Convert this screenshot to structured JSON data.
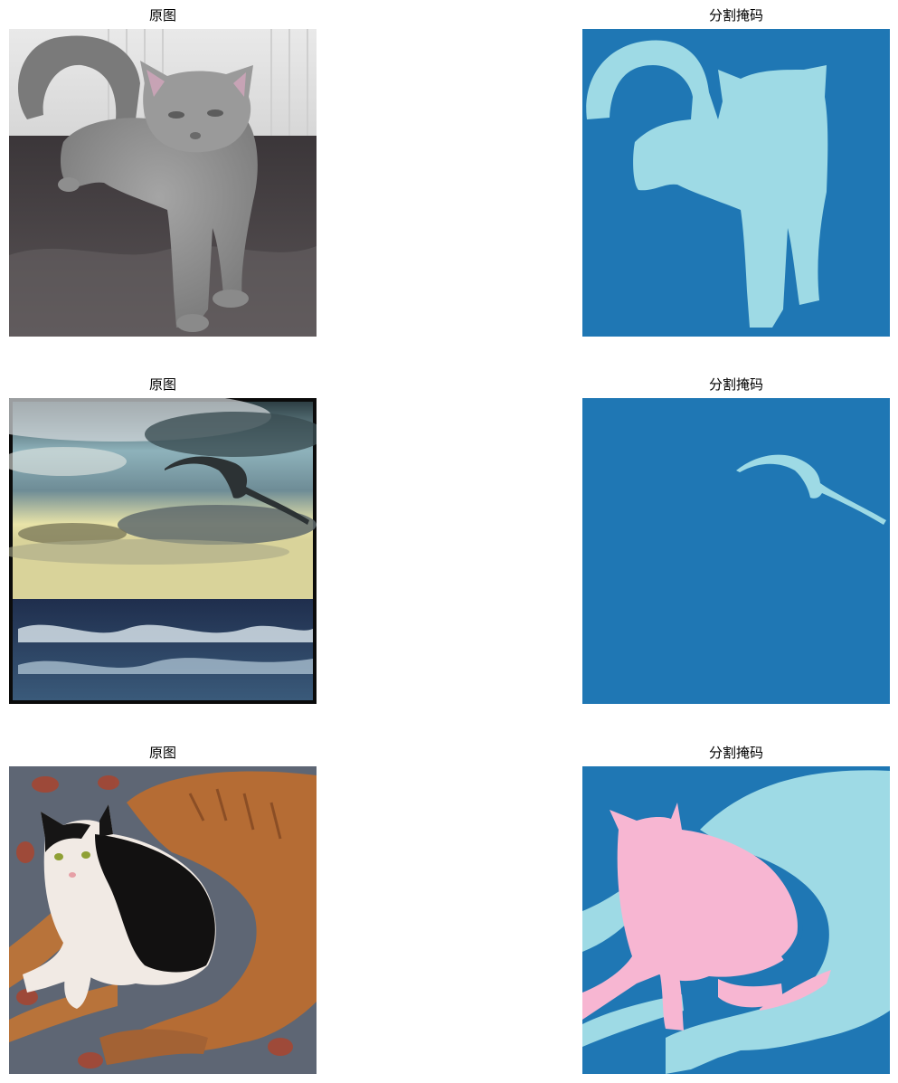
{
  "figure": {
    "rows": [
      {
        "image_title": "原图",
        "mask_title": "分割掩码",
        "image_subject": "gray cat standing on dark bedspread",
        "mask_classes": [
          "background",
          "cat"
        ]
      },
      {
        "image_title": "原图",
        "mask_title": "分割掩码",
        "image_subject": "seabird flying over stormy sea",
        "mask_classes": [
          "background",
          "bird"
        ]
      },
      {
        "image_title": "原图",
        "mask_title": "分割掩码",
        "image_subject": "black-and-white cat lying on a brown dog",
        "mask_classes": [
          "background",
          "dog",
          "cat"
        ]
      }
    ],
    "colors": {
      "background": "#1f77b4",
      "dog": "#9edae5",
      "cat_light": "#9edae5",
      "cat_pink": "#f7b6d2"
    }
  }
}
